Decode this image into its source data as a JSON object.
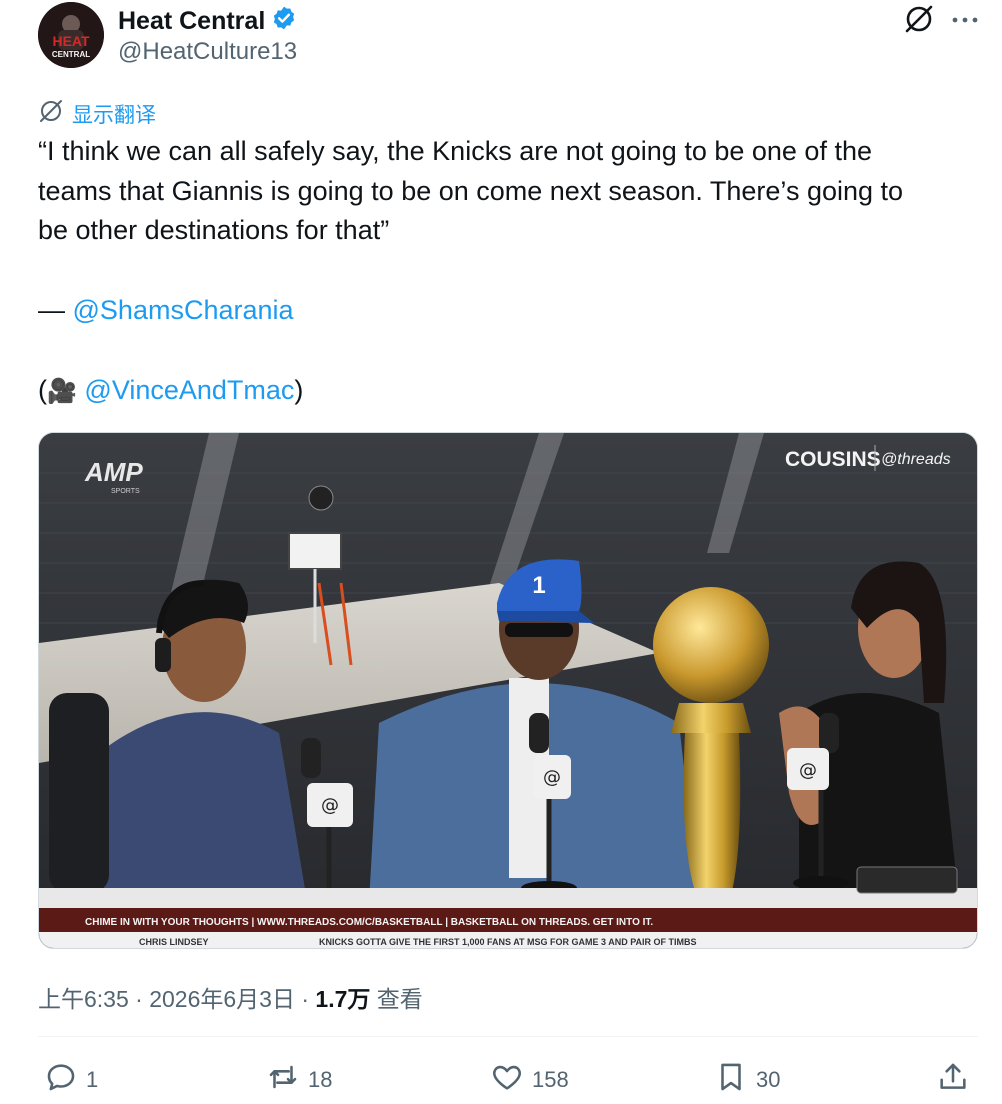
{
  "author": {
    "display_name": "Heat Central",
    "handle": "@HeatCulture13",
    "avatar_text": "HEAT",
    "avatar_subtext": "CENTRAL"
  },
  "translate_label": "显示翻译",
  "tweet": {
    "line1": "“I think we can all safely say, the Knicks are not going to be one of the",
    "line2": "teams that Giannis is going to be on come next season. There’s going to",
    "line3": "be other destinations for that”",
    "dash": "— ",
    "mention1": "@ShamsCharania",
    "paren_open": "(",
    "camera_glyph": "🎥",
    "mention2": "@VinceAndTmac",
    "paren_close": ")"
  },
  "media": {
    "logo_left": "AMP",
    "logo_left_sub": "SPORTS",
    "logo_right": "COUSINS",
    "logo_right2": "@threads",
    "cap_number": "1",
    "ticker_top": "CHIME IN WITH YOUR THOUGHTS | WWW.THREADS.COM/C/BASKETBALL | BASKETBALL ON THREADS. GET INTO IT.",
    "ticker_bottom_name": "CHRIS LINDSEY",
    "ticker_bottom_text": "KNICKS GOTTA GIVE THE FIRST 1,000 FANS AT MSG FOR GAME 3 AND PAIR OF TIMBS"
  },
  "meta": {
    "time": "上午6:35",
    "sep1": " · ",
    "date": "2026年6月3日",
    "sep2": " · ",
    "views": "1.7万",
    "views_label": " 查看"
  },
  "actions": {
    "replies": "1",
    "reposts": "18",
    "likes": "158",
    "bookmarks": "30"
  },
  "colors": {
    "accent": "#1d9bf0",
    "secondary_text": "#536471",
    "verified": "#1d9bf0"
  }
}
